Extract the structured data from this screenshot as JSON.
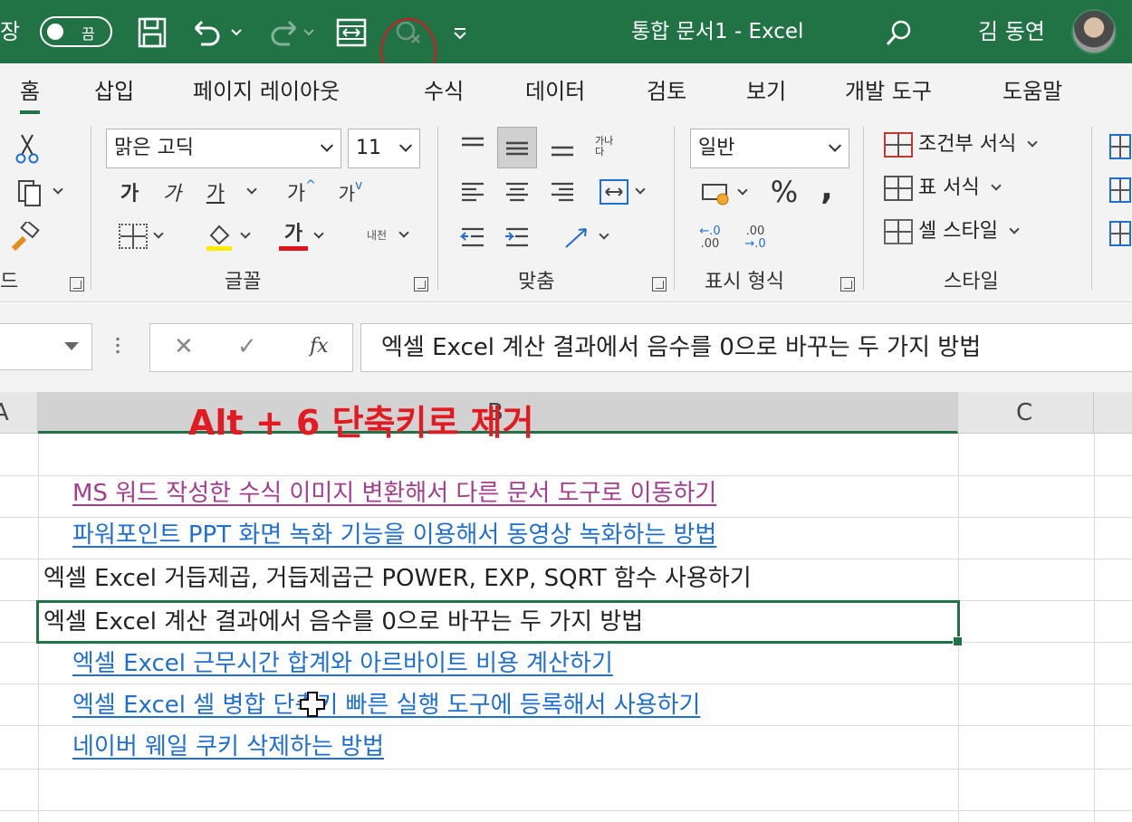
{
  "title_bar": {
    "autosave_left": "장",
    "toggle_label": "끔",
    "doc_title": "통합 문서1  -  Excel",
    "user_name": "김 동연"
  },
  "tabs": [
    "홈",
    "삽입",
    "페이지 레이아웃",
    "수식",
    "데이터",
    "검토",
    "보기",
    "개발 도구",
    "도움말"
  ],
  "ribbon": {
    "clipboard_label": "드",
    "font_name": "맑은 고딕",
    "font_size": "11",
    "bold": "가",
    "italic": "가",
    "underline": "가",
    "grow_font": "가",
    "shrink_font": "가",
    "font_color_char": "가",
    "phonetic": "내천",
    "font_group_label": "글꼴",
    "wrap_text": "가나다",
    "align_group_label": "맞춤",
    "number_format": "일반",
    "percent": "%",
    "comma": ",",
    "number_group_label": "표시 형식",
    "conditional_format": "조건부 서식",
    "format_as_table": "표 서식",
    "cell_styles": "셀 스타일",
    "styles_group_label": "스타일"
  },
  "formula_bar": {
    "fx": "fx",
    "content": "엑셀 Excel 계산 결과에서 음수를 0으로 바꾸는 두 가지 방법"
  },
  "sheet": {
    "col_a": "A",
    "col_b": "B",
    "col_c": "C",
    "annotation": "Alt + 6 단축키로 제거",
    "rows": [
      "MS 워드 작성한 수식 이미지 변환해서 다른 문서 도구로 이동하기",
      "파워포인트 PPT 화면 녹화 기능을 이용해서 동영상 녹화하는 방법",
      "엑셀 Excel 거듭제곱, 거듭제곱근 POWER, EXP, SQRT 함수 사용하기",
      "엑셀 Excel 계산 결과에서 음수를 0으로 바꾸는 두 가지 방법",
      "엑셀 Excel 근무시간 합계와 아르바이트 비용 계산하기",
      "엑셀 Excel 셀 병합 단축키 빠른 실행 도구에 등록해서 사용하기",
      "네이버 웨일 쿠키 삭제하는 방법"
    ]
  },
  "colors": {
    "excel_green": "#217346",
    "visited_link": "#a33e8f",
    "link": "#1f6fd1",
    "annotation": "#e21b23"
  }
}
